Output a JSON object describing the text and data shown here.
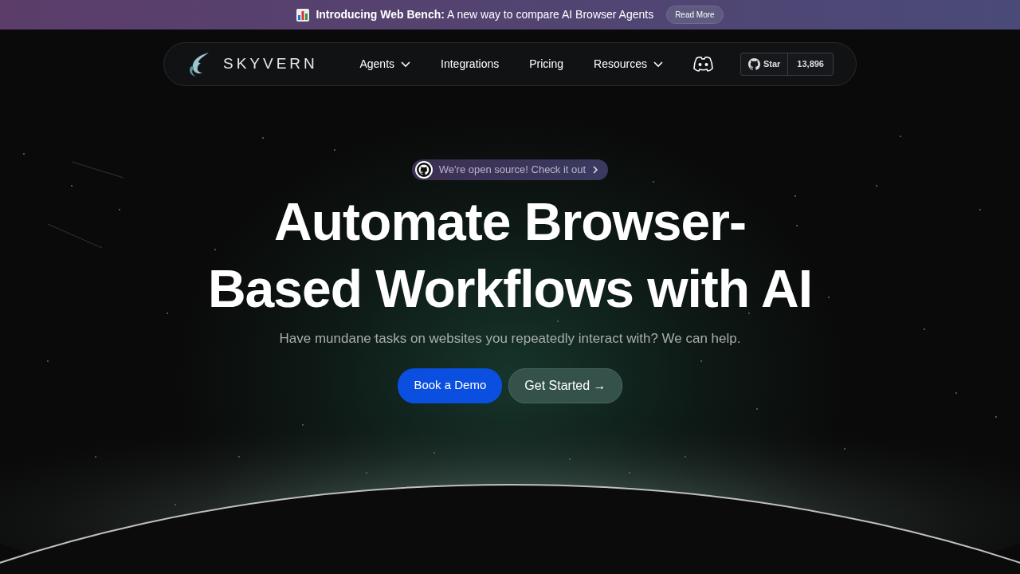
{
  "announcement": {
    "title": "Introducing Web Bench:",
    "text": "A new way to compare AI Browser Agents",
    "button": "Read More"
  },
  "navbar": {
    "brand": "SKYVERN",
    "links": [
      {
        "label": "Agents",
        "dropdown": true
      },
      {
        "label": "Integrations",
        "dropdown": false
      },
      {
        "label": "Pricing",
        "dropdown": false
      },
      {
        "label": "Resources",
        "dropdown": true
      }
    ],
    "github": {
      "label": "Star",
      "count": "13,896"
    }
  },
  "hero": {
    "pill": "We're open source! Check it out",
    "title_lines": [
      "Automate Browser-",
      "Based Workflows with AI"
    ],
    "subtitle": "Have mundane tasks on websites you repeatedly interact with? We can help.",
    "buttons": [
      {
        "label": "Book a Demo",
        "kind": "primary"
      },
      {
        "label": "Get Started →",
        "kind": "secondary"
      }
    ]
  }
}
